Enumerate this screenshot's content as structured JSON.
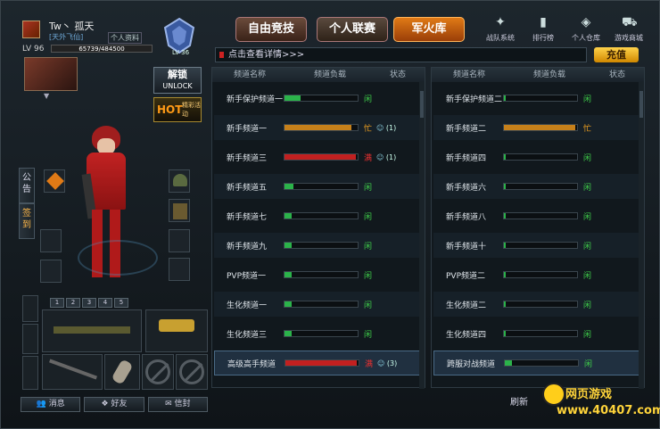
{
  "profile": {
    "name": "Tw丶 孤天",
    "team": "[天外飞仙]",
    "link": "个人资料",
    "level": "LV 96",
    "exp": "65739/484500",
    "rank_label": "LV 36"
  },
  "nav": {
    "tabs": [
      "自由竞技",
      "个人联赛",
      "军火库"
    ],
    "active": 2,
    "items": [
      {
        "label": "战队系统",
        "icon": "team-icon"
      },
      {
        "label": "排行榜",
        "icon": "ranking-icon"
      },
      {
        "label": "个人仓库",
        "icon": "warehouse-icon"
      },
      {
        "label": "游戏商城",
        "icon": "shop-icon"
      }
    ]
  },
  "notice": {
    "text": "点击查看详情>>>"
  },
  "recharge": "充值",
  "unlock": {
    "title": "解锁",
    "sub": "UNLOCK"
  },
  "hot": {
    "badge": "HOT",
    "text": "精彩活动"
  },
  "sidetabs": [
    "公告",
    "签到"
  ],
  "weapon_tabs": [
    "1",
    "2",
    "3",
    "4",
    "5"
  ],
  "bottom_buttons": [
    "消息",
    "好友",
    "信封"
  ],
  "table_headers": [
    "频道名称",
    "频道负载",
    "状态"
  ],
  "left_channels": [
    {
      "name": "新手保护频道一",
      "load": 0.22,
      "color": "#2bb34a",
      "status": "闲",
      "st": "g",
      "friends": ""
    },
    {
      "name": "新手频道一",
      "load": 0.92,
      "color": "#c6801a",
      "status": "忙",
      "st": "o",
      "friends": "(1)"
    },
    {
      "name": "新手频道三",
      "load": 0.98,
      "color": "#c22020",
      "status": "满",
      "st": "r",
      "friends": "(1)"
    },
    {
      "name": "新手频道五",
      "load": 0.12,
      "color": "#2bb34a",
      "status": "闲",
      "st": "g",
      "friends": ""
    },
    {
      "name": "新手频道七",
      "load": 0.1,
      "color": "#2bb34a",
      "status": "闲",
      "st": "g",
      "friends": ""
    },
    {
      "name": "新手频道九",
      "load": 0.1,
      "color": "#2bb34a",
      "status": "闲",
      "st": "g",
      "friends": ""
    },
    {
      "name": "PVP频道一",
      "load": 0.1,
      "color": "#2bb34a",
      "status": "闲",
      "st": "g",
      "friends": ""
    },
    {
      "name": "生化频道一",
      "load": 0.1,
      "color": "#2bb34a",
      "status": "闲",
      "st": "g",
      "friends": ""
    },
    {
      "name": "生化频道三",
      "load": 0.1,
      "color": "#2bb34a",
      "status": "闲",
      "st": "g",
      "friends": ""
    },
    {
      "name": "高级高手频道",
      "load": 0.98,
      "color": "#c22020",
      "status": "满",
      "st": "r",
      "friends": "(3)"
    }
  ],
  "right_channels": [
    {
      "name": "新手保护频道二",
      "load": 0.02,
      "color": "#2bb34a",
      "status": "闲",
      "st": "g"
    },
    {
      "name": "新手频道二",
      "load": 0.98,
      "color": "#c6801a",
      "status": "忙",
      "st": "o"
    },
    {
      "name": "新手频道四",
      "load": 0.02,
      "color": "#2bb34a",
      "status": "闲",
      "st": "g"
    },
    {
      "name": "新手频道六",
      "load": 0.02,
      "color": "#2bb34a",
      "status": "闲",
      "st": "g"
    },
    {
      "name": "新手频道八",
      "load": 0.02,
      "color": "#2bb34a",
      "status": "闲",
      "st": "g"
    },
    {
      "name": "新手频道十",
      "load": 0.02,
      "color": "#2bb34a",
      "status": "闲",
      "st": "g"
    },
    {
      "name": "PVP频道二",
      "load": 0.02,
      "color": "#2bb34a",
      "status": "闲",
      "st": "g"
    },
    {
      "name": "生化频道二",
      "load": 0.02,
      "color": "#2bb34a",
      "status": "闲",
      "st": "g"
    },
    {
      "name": "生化频道四",
      "load": 0.02,
      "color": "#2bb34a",
      "status": "闲",
      "st": "g"
    },
    {
      "name": "跨服对战频道",
      "load": 0.1,
      "color": "#2bb34a",
      "status": "闲",
      "st": "g"
    }
  ],
  "refresh": "刷新",
  "watermark": {
    "line1": "网页游戏",
    "line2": "www.40407.com"
  }
}
